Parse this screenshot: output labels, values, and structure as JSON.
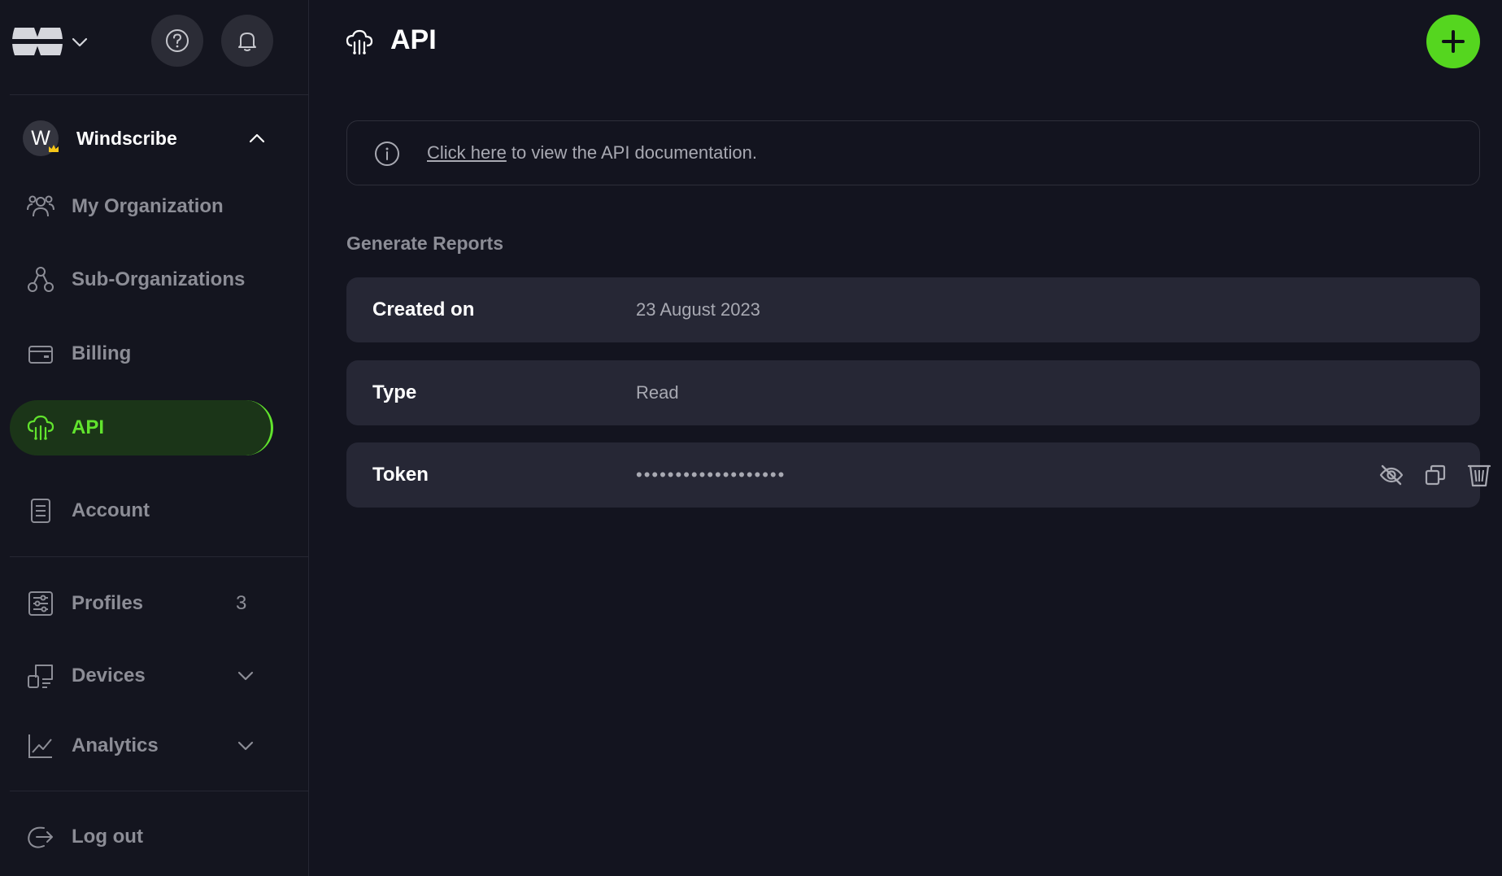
{
  "app": {
    "logo_icon": "windscribe-logo-icon"
  },
  "topbar": {
    "help_icon": "help-icon",
    "bell_icon": "bell-icon"
  },
  "org": {
    "avatar_letter": "W",
    "name": "Windscribe"
  },
  "sidebar": {
    "items": [
      {
        "label": "My Organization",
        "icon": "people-icon"
      },
      {
        "label": "Sub-Organizations",
        "icon": "sub-organizations-icon"
      },
      {
        "label": "Billing",
        "icon": "wallet-icon"
      },
      {
        "label": "API",
        "icon": "cloud-api-icon",
        "active": true
      },
      {
        "label": "Account",
        "icon": "document-icon"
      },
      {
        "label": "Profiles",
        "icon": "sliders-icon",
        "count": "3"
      },
      {
        "label": "Devices",
        "icon": "devices-icon"
      },
      {
        "label": "Analytics",
        "icon": "chart-icon"
      },
      {
        "label": "Log out",
        "icon": "logout-icon"
      }
    ]
  },
  "header": {
    "title": "API"
  },
  "info": {
    "link_text": "Click here",
    "text": " to view the API documentation."
  },
  "reports": {
    "title": "Generate Reports",
    "rows": [
      {
        "label": "Created on",
        "value": "23 August 2023"
      },
      {
        "label": "Type",
        "value": "Read"
      },
      {
        "label": "Token",
        "value": "•••••••••••••••••••"
      }
    ]
  },
  "colors": {
    "background": "#13141f",
    "accent": "#61e32d",
    "add_button": "#55d61f",
    "row_background": "#262735",
    "active_nav_background": "#1b3518"
  }
}
